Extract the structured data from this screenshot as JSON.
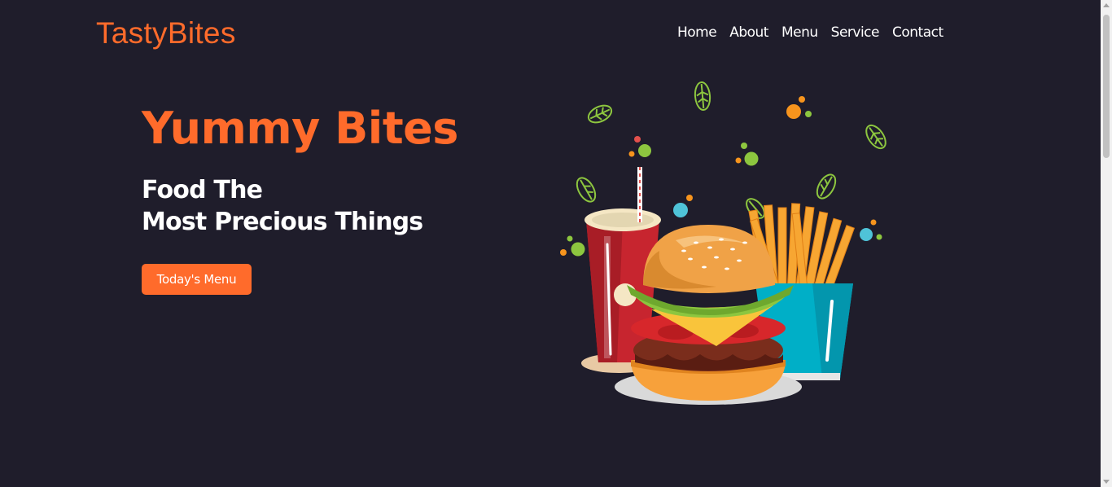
{
  "brand": {
    "name": "TastyBites"
  },
  "nav": {
    "links": [
      {
        "label": "Home"
      },
      {
        "label": "About"
      },
      {
        "label": "Menu"
      },
      {
        "label": "Service"
      },
      {
        "label": "Contact"
      }
    ]
  },
  "hero": {
    "title": "Yummy Bites",
    "subtitle_line1": "Food The",
    "subtitle_line2": "Most Precious Things",
    "cta_label": "Today's Menu",
    "illustration_icon": "burger-fries-drink-illustration"
  },
  "colors": {
    "background": "#1f1d2b",
    "accent": "#ff6b2b",
    "text": "#ffffff"
  }
}
